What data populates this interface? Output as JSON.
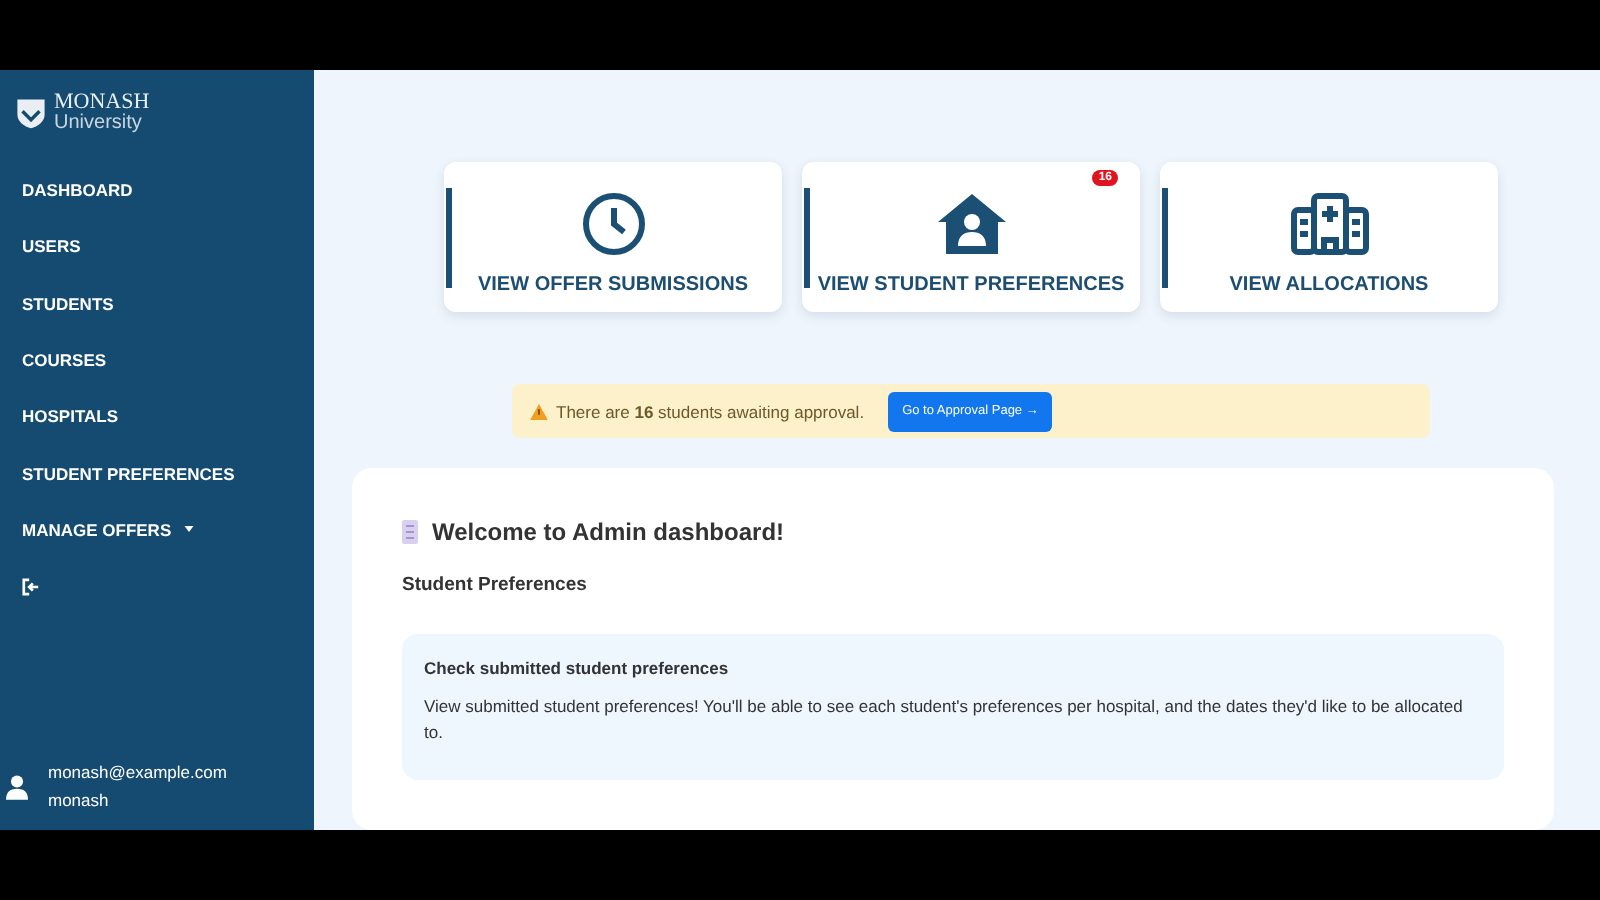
{
  "sidebar": {
    "logo": {
      "line_1": "MONASH",
      "line_2": "University"
    },
    "items": [
      {
        "kind": "link",
        "label": "DASHBOARD"
      },
      {
        "kind": "link",
        "label": "USERS"
      },
      {
        "kind": "link",
        "label": "STUDENTS"
      },
      {
        "kind": "link",
        "label": "COURSES"
      },
      {
        "kind": "link",
        "label": "HOSPITALS"
      },
      {
        "kind": "link",
        "label": "STUDENT PREFERENCES"
      },
      {
        "kind": "dropdown",
        "label": "MANAGE OFFERS"
      },
      {
        "kind": "logout"
      }
    ],
    "user": {
      "email": "monash@example.com",
      "name": "monash"
    }
  },
  "cards": [
    {
      "kind": "clock",
      "label": "VIEW OFFER SUBMISSIONS"
    },
    {
      "kind": "house-user",
      "label": "VIEW STUDENT PREFERENCES",
      "badge": "16"
    },
    {
      "kind": "hospital",
      "label": "VIEW ALLOCATIONS"
    }
  ],
  "alert": {
    "text": "There are **16** students awaiting approval.",
    "button": "Go to Approval Page →"
  },
  "welcome": {
    "title": "Welcome to Admin dashboard!",
    "section": "Student Preferences",
    "panel": {
      "title": "Check submitted student preferences",
      "text": "View submitted student preferences! You'll be able to see each student's preferences per hospital, and the dates they'd like to be allocated to."
    }
  }
}
